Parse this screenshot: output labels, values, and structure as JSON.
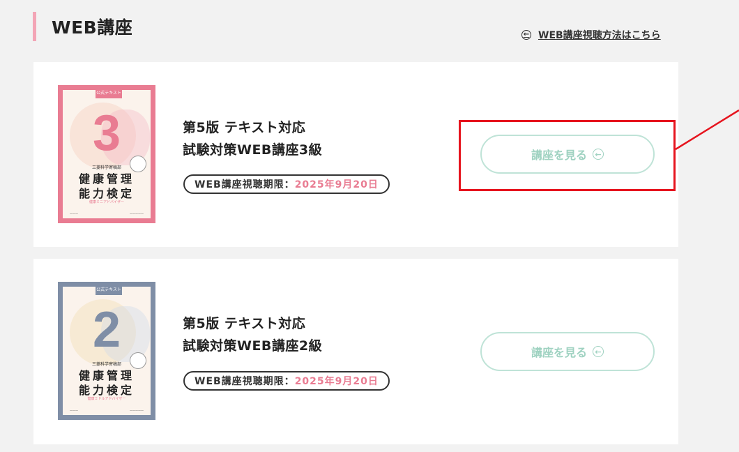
{
  "section": {
    "title": "WEB講座",
    "how_to_link": "WEB講座視聴方法はこちら",
    "how_to_icon": "arrow-left-circle-icon"
  },
  "courses": [
    {
      "cover": {
        "tag": "公式テキスト",
        "digit": "3",
        "small_top": "三菱科学寄稿部",
        "title_line1": "健康管理",
        "title_line2": "能力検定",
        "subtitle": "健康ミニアドバイザー",
        "color": "#e97c92"
      },
      "title_line1": "第5版 テキスト対応",
      "title_line2": "試験対策WEB講座3級",
      "period_label": "WEB講座視聴期限：",
      "period_value": "2025年9月20日",
      "button_label": "講座を見る"
    },
    {
      "cover": {
        "tag": "公式テキスト",
        "digit": "2",
        "small_top": "三菱科学寄稿部",
        "title_line1": "健康管理",
        "title_line2": "能力検定",
        "subtitle": "健康ミドルアドバイザー",
        "color": "#7f8ea6"
      },
      "title_line1": "第5版 テキスト対応",
      "title_line2": "試験対策WEB講座2級",
      "period_label": "WEB講座視聴期限：",
      "period_value": "2025年9月20日",
      "button_label": "講座を見る"
    }
  ],
  "colors": {
    "accent_pink": "#e97c92",
    "button_green": "#9fd2c1",
    "highlight_red": "#e6141e"
  }
}
